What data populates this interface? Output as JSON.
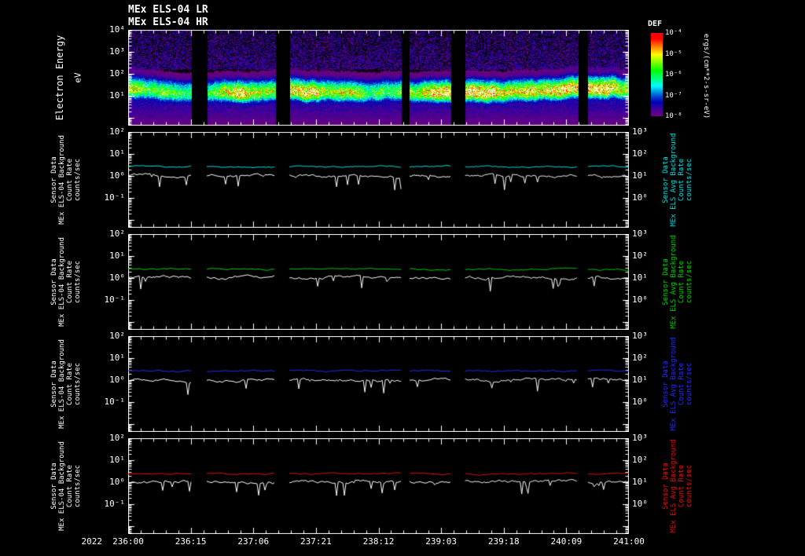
{
  "titles": {
    "line1": "MEx ELS-04 LR",
    "line2": "MEx ELS-04 HR"
  },
  "colors": {
    "background": "#000000",
    "foreground": "#ffffff",
    "cyan": "#00dddd",
    "green": "#00cc00",
    "blue": "#2a2aee",
    "red": "#dd1111"
  },
  "x_axis": {
    "year": "2022",
    "tick_labels": [
      "236:00",
      "236:15",
      "237:06",
      "237:21",
      "238:12",
      "239:03",
      "239:18",
      "240:09",
      "241:00"
    ],
    "format": "DOY:HH"
  },
  "gaps": [
    [
      0.126,
      0.157
    ],
    [
      0.295,
      0.322
    ],
    [
      0.545,
      0.562
    ],
    [
      0.644,
      0.673
    ],
    [
      0.898,
      0.918
    ]
  ],
  "chart_data": [
    {
      "type": "heatmap",
      "title": "MEx ELS-04 LR / MEx ELS-04 HR electron energy spectrogram",
      "ylabel": "Electron Energy",
      "yunits": "eV",
      "ytick_labels": [
        "10⁴",
        "10³",
        "10²",
        "10¹"
      ],
      "ytick_exps": [
        4,
        3,
        2,
        1
      ],
      "top_exp": 4,
      "y_axis_range_exp": [
        -0.36,
        4
      ],
      "x_span": "2022 236:00 to 241:00 (DOY:HH)",
      "band_center_log10_ev": 1.3,
      "band_peak_energy_ev": 20,
      "band_range_ev": [
        8,
        150
      ],
      "colorbar": {
        "title": "DEF",
        "units": "ergs/(cm**2-s-sr-eV)",
        "tick_labels": [
          "10⁻⁴",
          "10⁻⁵",
          "10⁻⁶",
          "10⁻⁷",
          "10⁻⁸"
        ]
      },
      "seed": 20220236
    },
    {
      "type": "line",
      "line_color": "#00dddd",
      "top_exp": 2,
      "left_axis_range_exp": [
        -2.36,
        2
      ],
      "right_axis_range_exp": [
        -1.36,
        3
      ],
      "left_tick_labels": [
        "10²",
        "10¹",
        "10⁰",
        "10⁻¹"
      ],
      "left_tick_exps": [
        2,
        1,
        0,
        -1
      ],
      "right_tick_labels": [
        "10³",
        "10²",
        "10¹",
        "10⁰"
      ],
      "right_tick_exps": [
        3,
        2,
        1,
        0
      ],
      "left_label_lines": [
        "Sensor Data",
        "MEx ELS-04 Background",
        "Count Rate",
        "counts/sec"
      ],
      "right_label_lines": [
        "Sensor Data",
        "MEx ELS Avg Background",
        "Count Rate",
        "counts/sec"
      ],
      "series": [
        {
          "name": "avg-background",
          "color": "#00dddd",
          "mean_log10": 0.42,
          "noise_log10": 0.05,
          "spike_prob": 0,
          "spike_depth_log10": 0,
          "seed": 1101
        },
        {
          "name": "sensor-data",
          "color": "#ffffff",
          "mean_log10": 0.02,
          "noise_log10": 0.1,
          "spike_prob": 0.06,
          "spike_depth_log10": 0.6,
          "seed": 1102
        }
      ],
      "deep_spike_segment": 1
    },
    {
      "type": "line",
      "line_color": "#00cc00",
      "top_exp": 2,
      "left_axis_range_exp": [
        -2.36,
        2
      ],
      "right_axis_range_exp": [
        -1.36,
        3
      ],
      "left_tick_labels": [
        "10²",
        "10¹",
        "10⁰",
        "10⁻¹"
      ],
      "left_tick_exps": [
        2,
        1,
        0,
        -1
      ],
      "right_tick_labels": [
        "10³",
        "10²",
        "10¹",
        "10⁰"
      ],
      "right_tick_exps": [
        3,
        2,
        1,
        0
      ],
      "left_label_lines": [
        "Sensor Data",
        "MEx ELS-04 Background",
        "Count Rate",
        "counts/sec"
      ],
      "right_label_lines": [
        "Sensor Data",
        "MEx ELS Avg Background",
        "Count Rate",
        "counts/sec"
      ],
      "series": [
        {
          "name": "avg-background",
          "color": "#00cc00",
          "mean_log10": 0.4,
          "noise_log10": 0.05,
          "spike_prob": 0,
          "spike_depth_log10": 0,
          "seed": 2101
        },
        {
          "name": "sensor-data",
          "color": "#ffffff",
          "mean_log10": 0.02,
          "noise_log10": 0.1,
          "spike_prob": 0.06,
          "spike_depth_log10": 0.6,
          "seed": 2102
        }
      ],
      "deep_spike_segment": 1
    },
    {
      "type": "line",
      "line_color": "#2a2aee",
      "top_exp": 2,
      "left_axis_range_exp": [
        -2.36,
        2
      ],
      "right_axis_range_exp": [
        -1.36,
        3
      ],
      "left_tick_labels": [
        "10²",
        "10¹",
        "10⁰",
        "10⁻¹"
      ],
      "left_tick_exps": [
        2,
        1,
        0,
        -1
      ],
      "right_tick_labels": [
        "10³",
        "10²",
        "10¹",
        "10⁰"
      ],
      "right_tick_exps": [
        3,
        2,
        1,
        0
      ],
      "left_label_lines": [
        "Sensor Data",
        "MEx ELS-04 Background",
        "Count Rate",
        "counts/sec"
      ],
      "right_label_lines": [
        "Sensor Data",
        "MEx ELS Avg Background",
        "Count Rate",
        "counts/sec"
      ],
      "series": [
        {
          "name": "avg-background",
          "color": "#2a2aee",
          "mean_log10": 0.42,
          "noise_log10": 0.05,
          "spike_prob": 0,
          "spike_depth_log10": 0,
          "seed": 3101
        },
        {
          "name": "sensor-data",
          "color": "#ffffff",
          "mean_log10": 0.02,
          "noise_log10": 0.1,
          "spike_prob": 0.06,
          "spike_depth_log10": 0.6,
          "seed": 3102
        }
      ],
      "deep_spike_segment": -1
    },
    {
      "type": "line",
      "line_color": "#dd1111",
      "top_exp": 2,
      "left_axis_range_exp": [
        -2.36,
        2
      ],
      "right_axis_range_exp": [
        -1.36,
        3
      ],
      "left_tick_labels": [
        "10²",
        "10¹",
        "10⁰",
        "10⁻¹"
      ],
      "left_tick_exps": [
        2,
        1,
        0,
        -1
      ],
      "right_tick_labels": [
        "10³",
        "10²",
        "10¹",
        "10⁰"
      ],
      "right_tick_exps": [
        3,
        2,
        1,
        0
      ],
      "left_label_lines": [
        "Sensor Data",
        "MEx ELS-04 Background",
        "Count Rate",
        "counts/sec"
      ],
      "right_label_lines": [
        "Sensor Data",
        "MEx ELS Avg Background",
        "Count Rate",
        "counts/sec"
      ],
      "series": [
        {
          "name": "avg-background",
          "color": "#dd1111",
          "mean_log10": 0.38,
          "noise_log10": 0.05,
          "spike_prob": 0,
          "spike_depth_log10": 0,
          "seed": 4101
        },
        {
          "name": "sensor-data",
          "color": "#ffffff",
          "mean_log10": 0.02,
          "noise_log10": 0.1,
          "spike_prob": 0.06,
          "spike_depth_log10": 0.6,
          "seed": 4102
        }
      ],
      "deep_spike_segment": -1
    }
  ]
}
